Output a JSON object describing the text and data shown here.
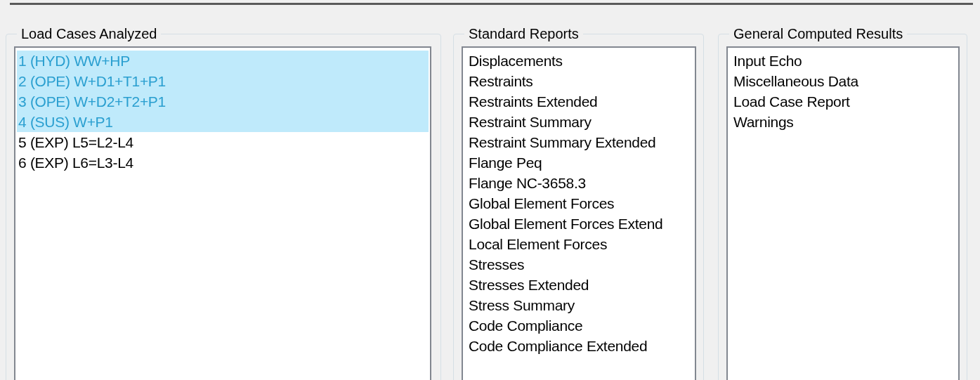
{
  "load_cases": {
    "title": "Load Cases Analyzed",
    "items": [
      {
        "label": "1 (HYD) WW+HP",
        "selected": true
      },
      {
        "label": "2 (OPE) W+D1+T1+P1",
        "selected": true
      },
      {
        "label": "3 (OPE) W+D2+T2+P1",
        "selected": true
      },
      {
        "label": "4 (SUS) W+P1",
        "selected": true
      },
      {
        "label": "5 (EXP) L5=L2-L4",
        "selected": false
      },
      {
        "label": "6 (EXP) L6=L3-L4",
        "selected": false
      }
    ]
  },
  "standard_reports": {
    "title": "Standard Reports",
    "items": [
      {
        "label": "Displacements",
        "selected": false
      },
      {
        "label": "Restraints",
        "selected": false
      },
      {
        "label": "Restraints Extended",
        "selected": false
      },
      {
        "label": "Restraint Summary",
        "selected": false
      },
      {
        "label": "Restraint Summary Extended",
        "selected": false
      },
      {
        "label": "Flange Peq",
        "selected": false
      },
      {
        "label": "Flange NC-3658.3",
        "selected": false
      },
      {
        "label": "Global Element Forces",
        "selected": false
      },
      {
        "label": "Global Element Forces Extend",
        "selected": false
      },
      {
        "label": "Local Element Forces",
        "selected": false
      },
      {
        "label": "Stresses",
        "selected": false
      },
      {
        "label": "Stresses Extended",
        "selected": false
      },
      {
        "label": "Stress Summary",
        "selected": false
      },
      {
        "label": "Code Compliance",
        "selected": false
      },
      {
        "label": "Code Compliance Extended",
        "selected": false
      }
    ]
  },
  "general_results": {
    "title": "General Computed Results",
    "items": [
      {
        "label": "Input Echo",
        "selected": false
      },
      {
        "label": "Miscellaneous Data",
        "selected": false
      },
      {
        "label": "Load Case Report",
        "selected": false
      },
      {
        "label": "Warnings",
        "selected": false
      }
    ]
  }
}
